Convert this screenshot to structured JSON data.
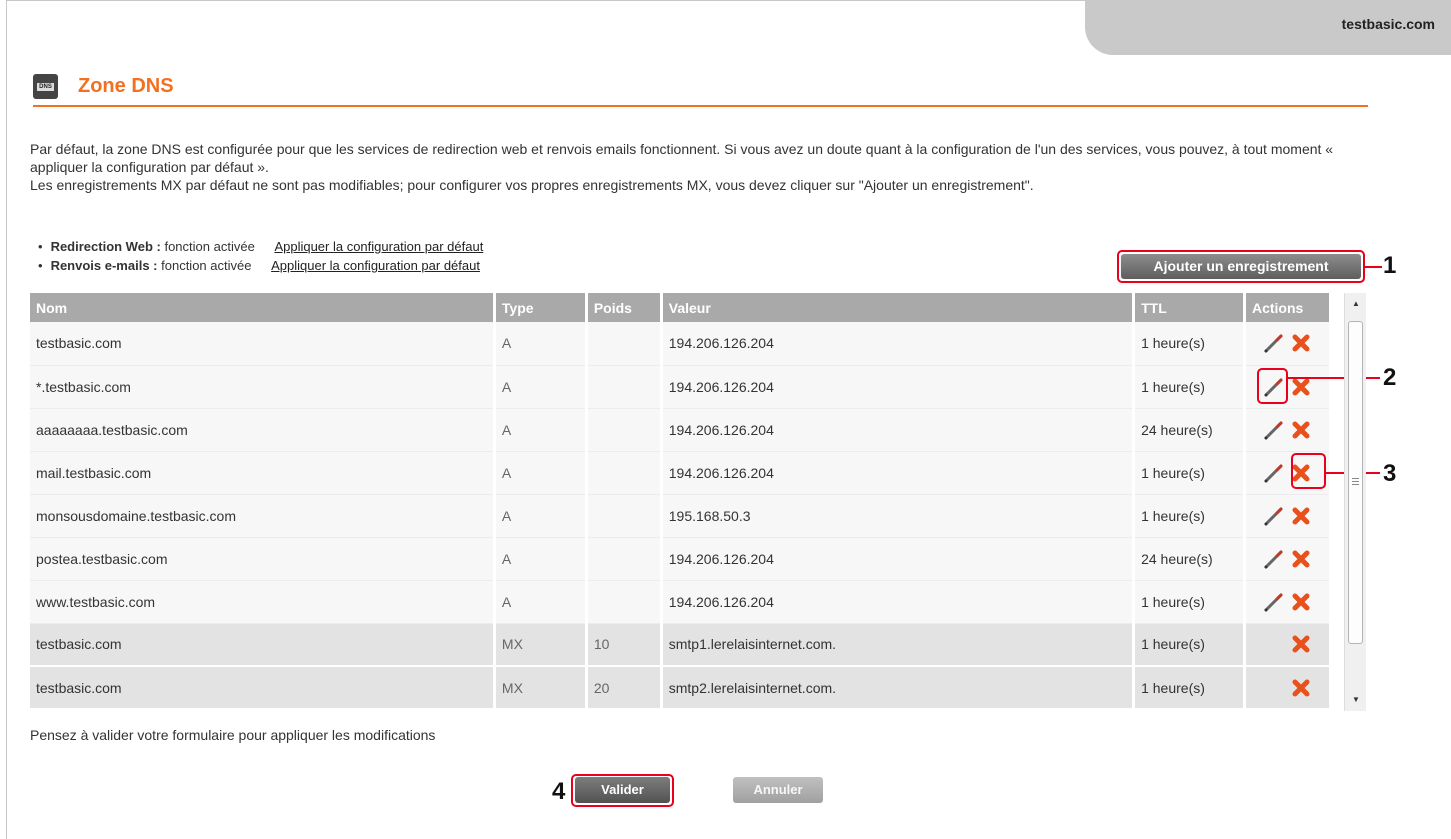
{
  "header": {
    "domain": "testbasic.com"
  },
  "page": {
    "icon_label": "DNS",
    "title": "Zone DNS",
    "intro_line1": "Par défaut, la zone DNS est configurée pour que les services de redirection web et renvois emails fonctionnent. Si vous avez un doute quant à la configuration de l'un des services, vous pouvez, à tout moment « appliquer la configuration par défaut ».",
    "intro_line2": "Les enregistrements MX par défaut ne sont pas modifiables; pour configurer vos propres enregistrements MX, vous devez cliquer sur \"Ajouter un enregistrement\"."
  },
  "services": [
    {
      "bullet": "•",
      "name": "Redirection Web :",
      "status": "fonction activée",
      "link": "Appliquer la configuration par défaut"
    },
    {
      "bullet": "•",
      "name": "Renvois e-mails :",
      "status": "fonction activée",
      "link": "Appliquer la configuration par défaut"
    }
  ],
  "add_button": "Ajouter un enregistrement",
  "table": {
    "headers": {
      "name": "Nom",
      "type": "Type",
      "weight": "Poids",
      "value": "Valeur",
      "ttl": "TTL",
      "actions": "Actions"
    },
    "rows": [
      {
        "name": "testbasic.com",
        "type": "A",
        "weight": "",
        "value": "194.206.126.204",
        "ttl": "1 heure(s)",
        "editable": true
      },
      {
        "name": "*.testbasic.com",
        "type": "A",
        "weight": "",
        "value": "194.206.126.204",
        "ttl": "1 heure(s)",
        "editable": true
      },
      {
        "name": "aaaaaaaa.testbasic.com",
        "type": "A",
        "weight": "",
        "value": "194.206.126.204",
        "ttl": "24 heure(s)",
        "editable": true
      },
      {
        "name": "mail.testbasic.com",
        "type": "A",
        "weight": "",
        "value": "194.206.126.204",
        "ttl": "1 heure(s)",
        "editable": true
      },
      {
        "name": "monsousdomaine.testbasic.com",
        "type": "A",
        "weight": "",
        "value": "195.168.50.3",
        "ttl": "1 heure(s)",
        "editable": true
      },
      {
        "name": "postea.testbasic.com",
        "type": "A",
        "weight": "",
        "value": "194.206.126.204",
        "ttl": "24 heure(s)",
        "editable": true
      },
      {
        "name": "www.testbasic.com",
        "type": "A",
        "weight": "",
        "value": "194.206.126.204",
        "ttl": "1 heure(s)",
        "editable": true
      },
      {
        "name": "testbasic.com",
        "type": "MX",
        "weight": "10",
        "value": "smtp1.lerelaisinternet.com.",
        "ttl": "1 heure(s)",
        "editable": false
      },
      {
        "name": "testbasic.com",
        "type": "MX",
        "weight": "20",
        "value": "smtp2.lerelaisinternet.com.",
        "ttl": "1 heure(s)",
        "editable": false
      }
    ]
  },
  "notice": "Pensez à valider votre formulaire pour appliquer les modifications",
  "buttons": {
    "validate": "Valider",
    "cancel": "Annuler"
  },
  "callouts": {
    "c1": "1",
    "c2": "2",
    "c3": "3",
    "c4": "4"
  },
  "colors": {
    "accent": "#f37021",
    "callout": "#e8001c",
    "header_bg": "#a9a9a9",
    "mx_row_bg": "#e3e3e3"
  },
  "icons": {
    "edit": "pencil-icon",
    "delete": "delete-x-icon"
  }
}
